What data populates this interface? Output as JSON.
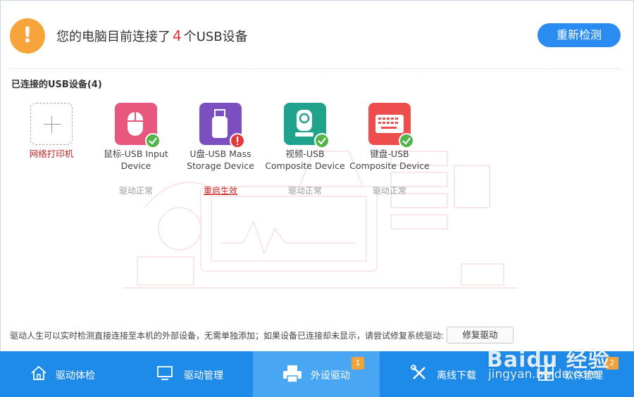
{
  "header": {
    "warning_symbol": "!",
    "title_prefix": "您的电脑目前连接了",
    "count": "4",
    "title_suffix": "个USB设备",
    "rescan_label": "重新检测"
  },
  "section_title": "已连接的USB设备(4)",
  "devices": [
    {
      "name": "网络打印机",
      "status": "",
      "icon": "add-printer-icon"
    },
    {
      "name": "鼠标-USB Input Device",
      "status": "驱动正常",
      "icon": "mouse-icon",
      "color": "#e8577e",
      "badge": "ok"
    },
    {
      "name": "U盘-USB Mass Storage Device",
      "status": "重启生效",
      "icon": "usb-drive-icon",
      "color": "#7b4fc0",
      "badge": "error"
    },
    {
      "name": "视频-USB Composite Device",
      "status": "驱动正常",
      "icon": "webcam-icon",
      "color": "#1fa38d",
      "badge": "ok"
    },
    {
      "name": "键盘-USB Composite Device",
      "status": "驱动正常",
      "icon": "keyboard-icon",
      "color": "#ee4d4d",
      "badge": "ok"
    }
  ],
  "bottom": {
    "message": "驱动人生可以实时检测直接连接至本机的外部设备，无需单独添加；如果设备已连接却未显示，请尝试修复系统驱动:",
    "repair_label": "修复驱动"
  },
  "tabs": [
    {
      "label": "驱动体检",
      "icon": "home-icon"
    },
    {
      "label": "驱动管理",
      "icon": "monitor-icon"
    },
    {
      "label": "外设驱动",
      "icon": "printer-icon",
      "badge": "1",
      "active": true
    },
    {
      "label": "离线下载",
      "icon": "tools-icon"
    },
    {
      "label": "软件管理",
      "icon": "software-icon",
      "badge": "2"
    }
  ],
  "watermark": {
    "logo": "Baidu 经验",
    "sub": "jingyan.baidu.com"
  },
  "colors": {
    "accent": "#2a8cf0",
    "tabbar": "#1e8be8",
    "warning": "#f7a53a",
    "error": "#c52424"
  }
}
